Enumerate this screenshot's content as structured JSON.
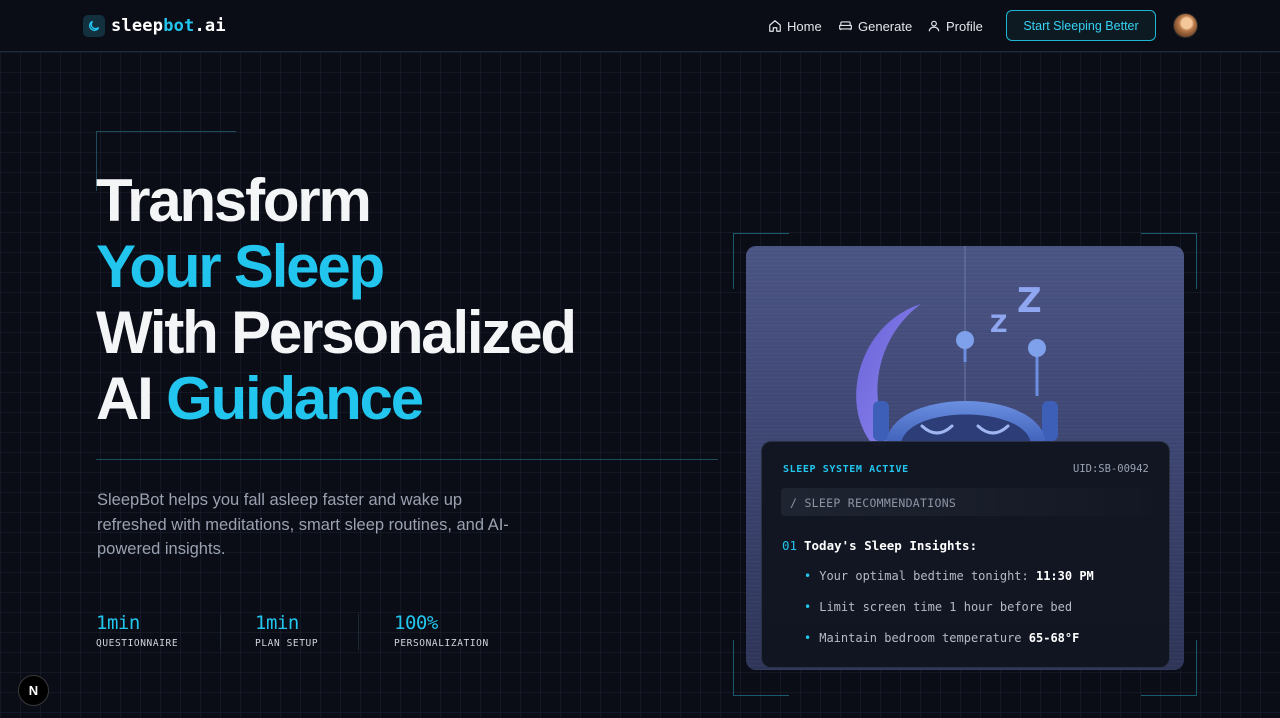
{
  "brand": {
    "part1": "sleep",
    "part2": "bot",
    "part3": ".ai",
    "accent": "#22c5ee"
  },
  "nav": {
    "items": [
      {
        "label": "Home",
        "icon": "home-icon"
      },
      {
        "label": "Generate",
        "icon": "sofa-icon"
      },
      {
        "label": "Profile",
        "icon": "user-icon"
      }
    ],
    "cta_label": "Start Sleeping Better"
  },
  "hero": {
    "line1": "Transform",
    "line2": "Your Sleep",
    "line3": "With Personalized",
    "line4_a": "AI",
    "line4_b": "Guidance",
    "description": "SleepBot helps you fall asleep faster and wake up refreshed with meditations, smart sleep routines, and AI-powered insights.",
    "stats": [
      {
        "value": "1min",
        "label": "QUESTIONNAIRE"
      },
      {
        "value": "1min",
        "label": "PLAN SETUP"
      },
      {
        "value": "100%",
        "label": "PERSONALIZATION"
      }
    ]
  },
  "panel": {
    "status": "SLEEP SYSTEM ACTIVE",
    "uid": "UID:SB-00942",
    "section": "/ SLEEP RECOMMENDATIONS",
    "insight_number": "01",
    "insight_title": "Today's Sleep Insights:",
    "bullets": [
      {
        "text": "Your optimal bedtime tonight:",
        "highlight": "11:30 PM"
      },
      {
        "text": "Limit screen time 1 hour before bed",
        "highlight": ""
      },
      {
        "text": "Maintain bedroom temperature",
        "highlight": "65-68°F"
      }
    ]
  },
  "illustration": {
    "zzz_large": "Z",
    "zzz_small": "Z"
  },
  "dev_badge": {
    "letter": "N"
  }
}
